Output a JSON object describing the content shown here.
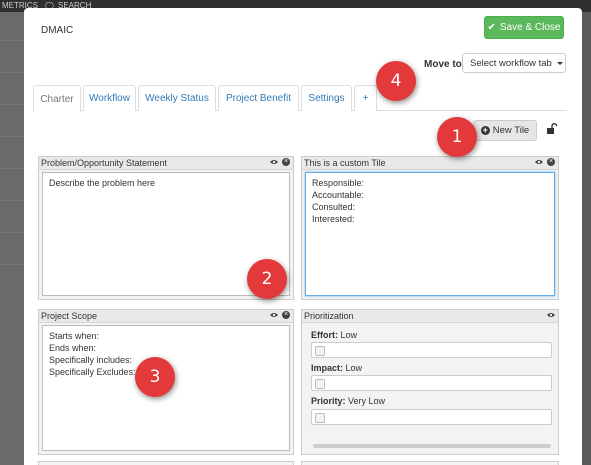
{
  "background": {
    "top_items": [
      "METRICS",
      "SEARCH"
    ]
  },
  "modal": {
    "title": "DMAIC",
    "save_label": "Save & Close",
    "move_to_label": "Move to",
    "select_workflow": "Select workflow tab"
  },
  "tabs": [
    {
      "label": "Charter",
      "active": true
    },
    {
      "label": "Workflow"
    },
    {
      "label": "Weekly Status"
    },
    {
      "label": "Project Benefit"
    },
    {
      "label": "Settings"
    },
    {
      "label": "+"
    }
  ],
  "toolbar": {
    "new_tile_label": "New Tile"
  },
  "tiles": {
    "problem": {
      "title": "Problem/Opportunity Statement",
      "body": "Describe the problem here"
    },
    "custom": {
      "title": "This is a custom Tile",
      "lines": [
        "Responsible:",
        "Accountable:",
        "Consulted:",
        "Interested:"
      ]
    },
    "scope": {
      "title": "Project Scope",
      "lines": [
        "Starts when:",
        "Ends when:",
        "",
        "Specifically includes:",
        "",
        "Specifically Excludes:"
      ]
    },
    "prioritization": {
      "title": "Prioritization",
      "items": [
        {
          "label": "Effort:",
          "value": "Low"
        },
        {
          "label": "Impact:",
          "value": "Low"
        },
        {
          "label": "Priority:",
          "value": "Very Low"
        }
      ]
    }
  },
  "callouts": [
    "1",
    "2",
    "3",
    "4"
  ],
  "colors": {
    "save_button": "#5cb85c",
    "tab_link": "#337ab7",
    "callout": "#e3393a"
  }
}
